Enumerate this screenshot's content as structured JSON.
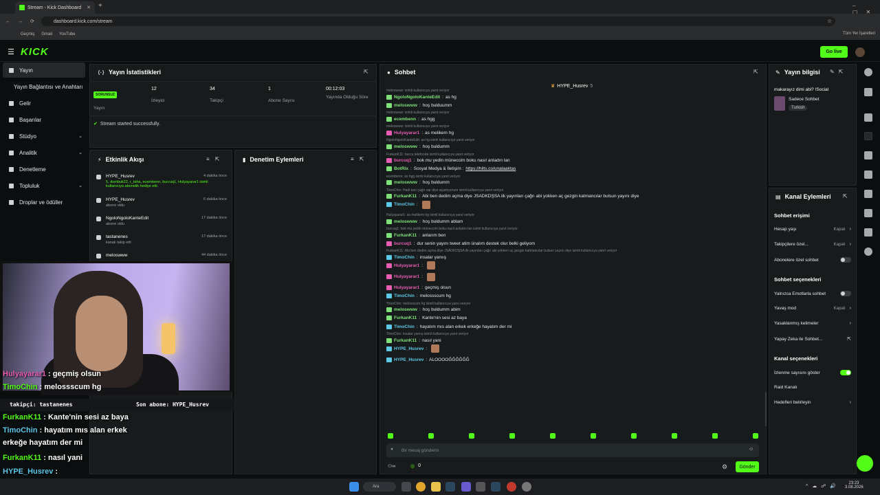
{
  "browser": {
    "tab_title": "Stream - Kick Dashboard",
    "url": "dashboard.kick.com/stream",
    "bookmarks": [
      "Geçmiş",
      "Gmail",
      "YouTube"
    ],
    "all_bookmarks": "Tüm Yer İşaretleri"
  },
  "header": {
    "logo": "KICK",
    "go_live": "Go live"
  },
  "sidebar": {
    "items": [
      {
        "label": "Yayın"
      },
      {
        "label": "Yayın Bağlantısı ve Anahtarı"
      },
      {
        "label": "Gelir"
      },
      {
        "label": "Başarılar"
      },
      {
        "label": "Stüdyo"
      },
      {
        "label": "Analitik"
      },
      {
        "label": "Denetleme"
      },
      {
        "label": "Topluluk"
      },
      {
        "label": "Droplar ve ödüller"
      }
    ]
  },
  "stats": {
    "title": "Yayın İstatistikleri",
    "badge": "SORUNSUZ",
    "items": [
      {
        "value": "",
        "label": "Yayın"
      },
      {
        "value": "12",
        "label": "İzleyici"
      },
      {
        "value": "34",
        "label": "Takipçi"
      },
      {
        "value": "1",
        "label": "Abone Sayısı"
      },
      {
        "value": "00:12:03",
        "label": "Yayında Olduğu Süre"
      }
    ],
    "success": "Stream started successfully."
  },
  "events": {
    "title": "Etkinlik Akışı",
    "items": [
      {
        "name": "HYPE_Husrev",
        "desc": "5, dumbuk22, r_taha, ecembenn, burcuq1, Hulyayarar1 isimli kullanıcıya abonelik hediye etti.",
        "time": "4 dakika önce"
      },
      {
        "name": "HYPE_Husrev",
        "desc": "abone oldu",
        "time": "6 dakika önce"
      },
      {
        "name": "NgoloNgoloKanteEdit",
        "desc": "abone oldu",
        "time": "17 dakika önce"
      },
      {
        "name": "tastanenes",
        "desc": "kanalı takip etti",
        "time": "17 dakika önce"
      },
      {
        "name": "meloswww",
        "desc": "",
        "time": "44 dakika önce"
      }
    ]
  },
  "moderation": {
    "title": "Denetim Eylemleri"
  },
  "chat": {
    "title": "Sohbet",
    "pinned": "HYPE_Husrev",
    "pinned_count": "5",
    "lines": [
      {
        "reply": "meloswww: isimli kullanıcıya yanıt veriyor"
      },
      {
        "user": "NgoloNgoloKanteEdit",
        "msg": "as hg",
        "color": "#7fe07a"
      },
      {
        "user": "meloswww",
        "msg": "hoş bulduumm",
        "color": "#7fe07a"
      },
      {
        "reply": "meloswww: isimli kullanıcıya yanıt veriyor"
      },
      {
        "user": "ecembenn",
        "msg": "as hgg",
        "color": "#7fe07a"
      },
      {
        "reply": "meloswww: isimli kullanıcıya yanıt veriyor"
      },
      {
        "user": "Hulyayarar1",
        "msg": "as melikem hg",
        "color": "#e85cb4"
      },
      {
        "reply": "NgoloNgoloKanteEdit: as hg isimli kullanıcıya yanıt veriyor"
      },
      {
        "user": "meloswww",
        "msg": "hoş buldumm",
        "color": "#7fe07a"
      },
      {
        "reply": "FurkanK11: burcu telefonda isimli kullanıcıya yanıt veriyor"
      },
      {
        "user": "burcuq1",
        "msg": "bok mu yedin müneccim boku nasıl anladın lan",
        "color": "#e85cb4"
      },
      {
        "user": "BotRix",
        "msg": "Sosyal Medya & İletişim :",
        "link": "https://hilts.co/unalaaktas",
        "color": "#7fe07a"
      },
      {
        "reply": "ecembenn: as hgg isimli kullanıcıya yanıt veriyor"
      },
      {
        "user": "meloswww",
        "msg": "hoş buldumm",
        "color": "#7fe07a"
      },
      {
        "reply": "TimoChin: Hadi ben çağrı var diye açamıyorum isimli kullanıcıya yanıt veriyor"
      },
      {
        "user": "FurkanK11",
        "msg": "Abi ben dedim açma diye JSADKDŞSA ilk yayınları çağrı abi yokken aç gezgin katmancılar bulsun yayını diye",
        "color": "#7fe07a"
      },
      {
        "user": "TimoChin",
        "msg": "",
        "color": "#5ec8e8"
      },
      {
        "reply": "Hulyayarar1: as melikem hg isimli kullanıcıya yanıt veriyor"
      },
      {
        "user": "meloswww",
        "msg": "hoş buldumm ablam",
        "color": "#7fe07a"
      },
      {
        "reply": "burcuq1: bok mu yedin müneccim boku nasıl anladın lan isimli kullanıcıya yanıt veriyor"
      },
      {
        "user": "FurkanK11",
        "msg": "anlarım ben",
        "color": "#7fe07a"
      },
      {
        "user": "burcuq1",
        "msg": "dur senin yayını tweet atim ünalım destek olur belki geliyom",
        "color": "#e85cb4"
      },
      {
        "reply": "FurkanK11: Abi ben dedim açma diye JSADKDŞSA ilk yayınları çağrı abi yokken aç gezgin katmancılar bulsun yayını diye isimli kullanıcıya yanıt veriyor"
      },
      {
        "user": "TimoChin",
        "msg": "insalar yanıış",
        "color": "#5ec8e8"
      },
      {
        "user": "Hulyayarar1",
        "msg": "",
        "color": "#e85cb4"
      },
      {
        "user": "Hulyayarar1",
        "msg": "",
        "color": "#e85cb4"
      },
      {
        "user": "Hulyayarar1",
        "msg": "geçmiş olsun",
        "color": "#e85cb4"
      },
      {
        "user": "TimoChin",
        "msg": "melossscum hg",
        "color": "#5ec8e8"
      },
      {
        "reply": "TimoChin: melosscum hg isimli kullanıcıya yanıt veriyor"
      },
      {
        "user": "meloswww",
        "msg": "hoş buldumm abim",
        "color": "#7fe07a"
      },
      {
        "user": "FurkanK11",
        "msg": "Kante'nin sesi az baya",
        "color": "#7fe07a"
      },
      {
        "user": "TimoChin",
        "msg": "hayatım mıs alan erkek erkeğe hayatım der mi",
        "color": "#5ec8e8"
      },
      {
        "reply": "TimoChin: insalar yanıış isimli kullanıcıya yanıt veriyor"
      },
      {
        "user": "FurkanK11",
        "msg": "nasıl yani",
        "color": "#7fe07a"
      },
      {
        "user": "HYPE_Husrev",
        "msg": "",
        "color": "#5ec8e8"
      },
      {
        "user": "HYPE_Husrev",
        "msg": "ALOOOOĞĞĞĞĞĞ",
        "color": "#5ec8e8"
      }
    ],
    "input_placeholder": "Bir mesaj gönderin",
    "send": "Gönder",
    "points": "0"
  },
  "stream_info": {
    "title": "Yayın bilgisi",
    "stream_title": "makarayız dimi abi? !Social",
    "category": "Sadece Sohbet",
    "language": "Turkish"
  },
  "channel_actions": {
    "title": "Kanal Eylemleri",
    "sections": [
      {
        "heading": "Sohbet erişimi",
        "rows": [
          {
            "label": "Hesap yaşı",
            "value": "Kapalı",
            "type": "chevron"
          },
          {
            "label": "Takipçilere özel...",
            "value": "Kapalı",
            "type": "chevron"
          },
          {
            "label": "Abonelere özel sohbet",
            "value": "",
            "type": "toggle",
            "on": false
          }
        ]
      },
      {
        "heading": "Sohbet seçenekleri",
        "rows": [
          {
            "label": "Yalnızca Emotlarla sohbet",
            "value": "",
            "type": "toggle",
            "on": false
          },
          {
            "label": "Yavaş mod",
            "value": "Kapalı",
            "type": "chevron"
          },
          {
            "label": "Yasaklanmış kelimeler",
            "value": "",
            "type": "chevron"
          },
          {
            "label": "Yapay Zeka ile Sohbet...",
            "value": "",
            "type": "external"
          }
        ]
      },
      {
        "heading": "Kanal seçenekleri",
        "rows": [
          {
            "label": "İzlenme sayısını göster",
            "value": "",
            "type": "toggle",
            "on": true
          },
          {
            "label": "Raid Kanalı",
            "value": "",
            "type": "none"
          },
          {
            "label": "Hedefleri belirleyin",
            "value": "",
            "type": "chevron"
          }
        ]
      }
    ]
  },
  "overlay": {
    "lines": [
      {
        "user": "Hulyayarar1",
        "msg": ": geçmiş olsun",
        "color": "#e85cb4"
      },
      {
        "user": "TimoChin",
        "msg": ": melossscum hg",
        "color": "#53fc18"
      },
      {
        "user": "FurkanK11",
        "msg": ": Kante'nin sesi az baya",
        "color": "#53fc18"
      },
      {
        "user": "TimoChin",
        "msg": ": hayatım mıs alan erkek",
        "color": "#5ec8e8"
      },
      {
        "user": "",
        "msg": "erkeğe hayatım der mi",
        "color": "#fff"
      },
      {
        "user": "FurkanK11",
        "msg": ": nasıl yani",
        "color": "#53fc18"
      },
      {
        "user": "HYPE_Husrev",
        "msg": ":",
        "color": "#5ec8e8"
      },
      {
        "user": "HYPE_Husrev",
        "msg": ": ALOOOOĞĞĞĞĞĞ",
        "color": "#5ec8e8"
      }
    ],
    "ticker_follower": "takipçi: tastanenes",
    "ticker_sub": "Son abone: HYPE_Husrev"
  },
  "taskbar": {
    "search": "Ara",
    "time": "23:23",
    "date": "3.08.2026"
  }
}
